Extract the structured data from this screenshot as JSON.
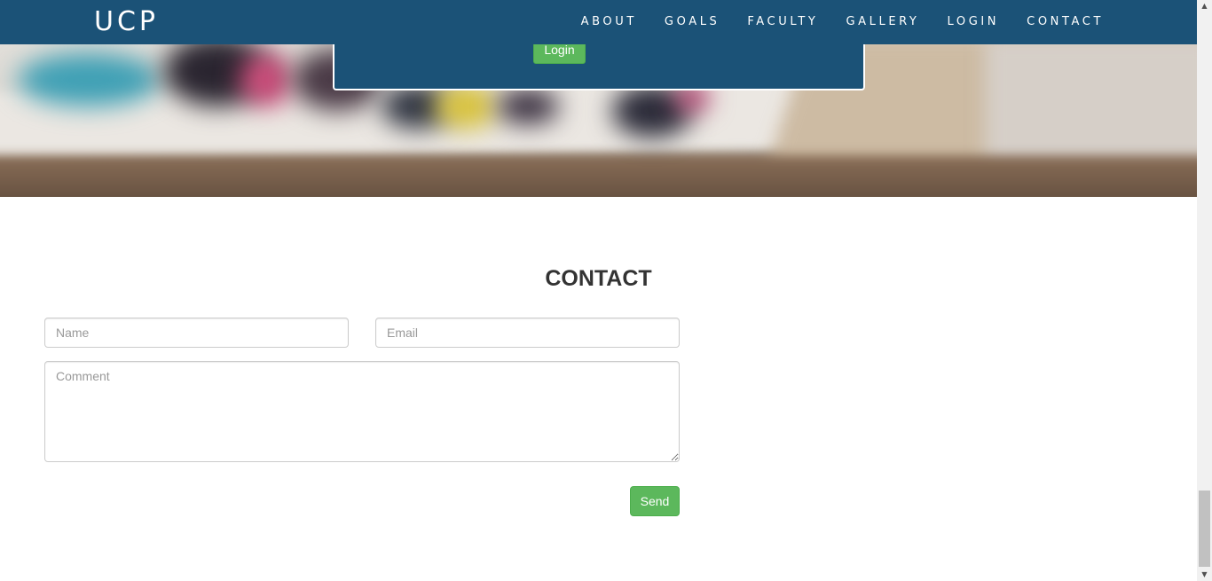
{
  "navbar": {
    "brand": "UCP",
    "items": [
      {
        "label": "ABOUT"
      },
      {
        "label": "GOALS"
      },
      {
        "label": "FACULTY"
      },
      {
        "label": "GALLERY"
      },
      {
        "label": "LOGIN"
      },
      {
        "label": "CONTACT"
      }
    ]
  },
  "login_panel": {
    "button_label": "Login"
  },
  "contact": {
    "title": "CONTACT",
    "name_placeholder": "Name",
    "email_placeholder": "Email",
    "comment_placeholder": "Comment",
    "send_label": "Send"
  },
  "colors": {
    "navbar_bg": "#1b5277",
    "button_green": "#5cb85c"
  }
}
